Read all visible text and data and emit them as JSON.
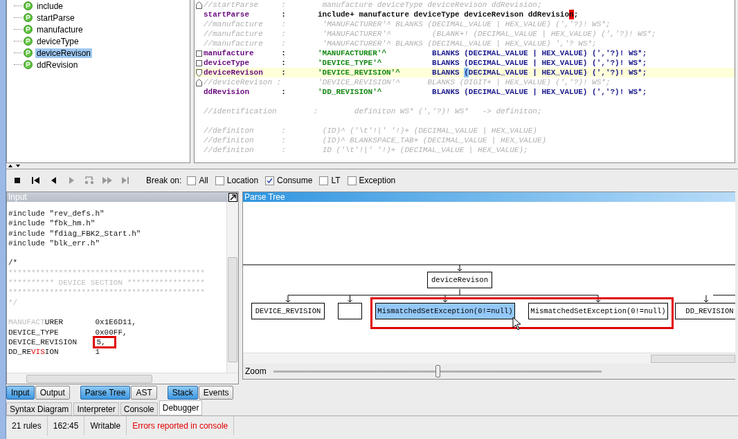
{
  "rules": [
    {
      "name": "include",
      "selected": false
    },
    {
      "name": "startParse",
      "selected": false
    },
    {
      "name": "manufacture",
      "selected": false
    },
    {
      "name": "deviceType",
      "selected": false
    },
    {
      "name": "deviceRevison",
      "selected": true
    },
    {
      "name": "ddRevision",
      "selected": false
    }
  ],
  "editor": {
    "lines": [
      {
        "kind": "comment",
        "fold": {
          "kind": "up"
        },
        "text": "//startParse     :        manufacture deviceType deviceRevison ddRevision;"
      },
      {
        "kind": "rule",
        "name": "startParse",
        "colon": ":",
        "highlighted": false,
        "body": [
          {
            "kind": "plain",
            "text": "include+ manufacture deviceType deviceRevison ddRevisio"
          },
          {
            "kind": "caret",
            "text": "n"
          },
          {
            "kind": "plain",
            "text": ";"
          }
        ]
      },
      {
        "kind": "comment",
        "text": "//manufacture    :        'MANUFACTURER'^ BLANKS (DECIMAL_VALUE | HEX_VALUE) (','?)! WS*;"
      },
      {
        "kind": "comment",
        "text": "//manufacture    :        'MANUFACTURER'^         (BLANK+! (DECIMAL_VALUE | HEX_VALUE) (','?)! WS*;"
      },
      {
        "kind": "comment",
        "text": "//manufacture    :        'MANUFACTURER'^ BLANKS (DECIMAL_VALUE | HEX_VALUE) ','? WS*;"
      },
      {
        "kind": "rule",
        "fold": {
          "kind": "box"
        },
        "name": "manufacture",
        "colon": ":",
        "highlighted": false,
        "body": [
          {
            "kind": "literal",
            "text": "'MANUFACTURER'^"
          },
          {
            "kind": "token",
            "text": "          BLANKS (DECIMAL_VALUE | HEX_VALUE) (','?)! WS*;"
          }
        ]
      },
      {
        "kind": "rule",
        "fold": {
          "kind": "box"
        },
        "name": "deviceType",
        "colon": ":",
        "highlighted": false,
        "body": [
          {
            "kind": "literal",
            "text": "'DEVICE_TYPE'^"
          },
          {
            "kind": "token",
            "text": "           BLANKS (DECIMAL_VALUE | HEX_VALUE) (','?)! WS*;"
          }
        ]
      },
      {
        "kind": "rule",
        "fold": {
          "kind": "down"
        },
        "name": "deviceRevison",
        "colon": ":",
        "highlighted": true,
        "body": [
          {
            "kind": "literal",
            "text": "'DEVICE_REVISION'^"
          },
          {
            "kind": "token",
            "text": "       BLANKS "
          },
          {
            "kind": "match",
            "text": "("
          },
          {
            "kind": "token",
            "text": "DECIMAL_VALUE | HEX_VALUE) (','?)! WS*;"
          }
        ]
      },
      {
        "kind": "comment",
        "fold": {
          "kind": "up"
        },
        "text": "//deviceRevison :        'DEVICE_REVISION'^      BLANKS (DIGIT+ | HEX_VALUE) (','?)! WS*;"
      },
      {
        "kind": "rule",
        "name": "ddRevision",
        "colon": ":",
        "highlighted": false,
        "body": [
          {
            "kind": "literal",
            "text": "'DD_REVISION'^"
          },
          {
            "kind": "token",
            "text": "           BLANKS (DECIMAL_VALUE | HEX_VALUE) (','?)! WS*;"
          }
        ]
      },
      {
        "kind": "blank"
      },
      {
        "kind": "comment",
        "text": "//identification        :        definiton WS* (','?)! WS*   -> definiton;"
      },
      {
        "kind": "blank"
      },
      {
        "kind": "comment",
        "text": "//definiton      :        (ID)^ ('\\t'!|' '!)+ (DECIMAL_VALUE | HEX_VALUE)"
      },
      {
        "kind": "comment",
        "text": "//definiton      :        (ID)^ BLANKSPACE_TAB+ (DECIMAL_VALUE | HEX_VALUE)"
      },
      {
        "kind": "comment",
        "text": "//definiton      :        ID ('\\t'!|' '!)+ (DECIMAL_VALUE | HEX_VALUE);"
      }
    ]
  },
  "toolbar": {
    "buttons": [
      {
        "kind": "stop",
        "disabled": false
      },
      {
        "kind": "first",
        "disabled": false
      },
      {
        "kind": "back",
        "disabled": false
      },
      {
        "kind": "forward",
        "disabled": true
      },
      {
        "kind": "step",
        "disabled": true
      },
      {
        "kind": "fast",
        "disabled": true
      },
      {
        "kind": "last",
        "disabled": true
      }
    ],
    "break_label": "Break on:",
    "break_options": [
      {
        "label": "All",
        "checked": false
      },
      {
        "label": "Location",
        "checked": false
      },
      {
        "label": "Consume",
        "checked": true
      },
      {
        "label": "LT",
        "checked": false
      },
      {
        "label": "Exception",
        "checked": false
      }
    ]
  },
  "input_panel": {
    "title": "Input",
    "lines": [
      {
        "kind": "text",
        "segments": [
          {
            "kind": "normal",
            "text": "#include \"rev_defs.h\""
          }
        ]
      },
      {
        "kind": "text",
        "segments": [
          {
            "kind": "normal",
            "text": "#include \"fbk_hm.h\""
          }
        ]
      },
      {
        "kind": "text",
        "segments": [
          {
            "kind": "normal",
            "text": "#include \"fdiag_FBK2_Start.h\""
          }
        ]
      },
      {
        "kind": "text",
        "segments": [
          {
            "kind": "normal",
            "text": "#include \"blk_err.h\""
          }
        ]
      },
      {
        "kind": "blank"
      },
      {
        "kind": "text",
        "segments": [
          {
            "kind": "normal",
            "text": "/*"
          }
        ]
      },
      {
        "kind": "text",
        "segments": [
          {
            "kind": "dim",
            "text": "*******************************************"
          }
        ]
      },
      {
        "kind": "text",
        "segments": [
          {
            "kind": "dim",
            "text": "********** DEVICE SECTION *****************"
          }
        ]
      },
      {
        "kind": "text",
        "segments": [
          {
            "kind": "dim",
            "text": "*******************************************"
          }
        ]
      },
      {
        "kind": "text",
        "segments": [
          {
            "kind": "dim",
            "text": "*/"
          }
        ]
      },
      {
        "kind": "blank"
      },
      {
        "kind": "text",
        "segments": [
          {
            "kind": "dim",
            "text": "MANUFACT"
          },
          {
            "kind": "normal",
            "text": "URER       0x1E6D11,"
          }
        ]
      },
      {
        "kind": "text",
        "segments": [
          {
            "kind": "normal",
            "text": "DEVICE_TYPE        0x00FF,"
          }
        ]
      },
      {
        "kind": "text",
        "segments": [
          {
            "kind": "normal",
            "text": "DEVICE_REVISION    "
          },
          {
            "kind": "boxed",
            "text": "5,"
          }
        ]
      },
      {
        "kind": "text",
        "segments": [
          {
            "kind": "normal",
            "text": "DD_RE"
          },
          {
            "kind": "error",
            "text": "VIS"
          },
          {
            "kind": "normal",
            "text": "ION        1"
          }
        ]
      }
    ]
  },
  "parse_tree": {
    "title": "Parse Tree",
    "root": "deviceRevison",
    "children": [
      {
        "label": "DEVICE_REVISION",
        "selected": false
      },
      {
        "selected": false
      },
      {
        "label": "MismatchedSetException(0!=null)",
        "selected": true
      },
      {
        "label": "MismatchedSetException(0!=null)",
        "selected": false
      },
      {
        "label": "DD_REVISION",
        "selected": false
      }
    ],
    "zoom_label": "Zoom",
    "zoom": {
      "level": 0.5
    }
  },
  "view_buttons": [
    {
      "label": "Input",
      "selected": true
    },
    {
      "label": "Output",
      "selected": false
    },
    {
      "label": "Parse Tree",
      "selected": true
    },
    {
      "label": "AST",
      "selected": false
    },
    {
      "label": "Stack",
      "selected": true
    },
    {
      "label": "Events",
      "selected": false
    }
  ],
  "tabs": [
    {
      "label": "Syntax Diagram",
      "selected": false
    },
    {
      "label": "Interpreter",
      "selected": false
    },
    {
      "label": "Console",
      "selected": false
    },
    {
      "label": "Debugger",
      "selected": true
    }
  ],
  "status_bar": [
    {
      "text": "21 rules",
      "kind": "info"
    },
    {
      "text": "162:45",
      "kind": "info"
    },
    {
      "text": "Writable",
      "kind": "info"
    },
    {
      "text": "Errors reported in console",
      "kind": "error"
    }
  ]
}
